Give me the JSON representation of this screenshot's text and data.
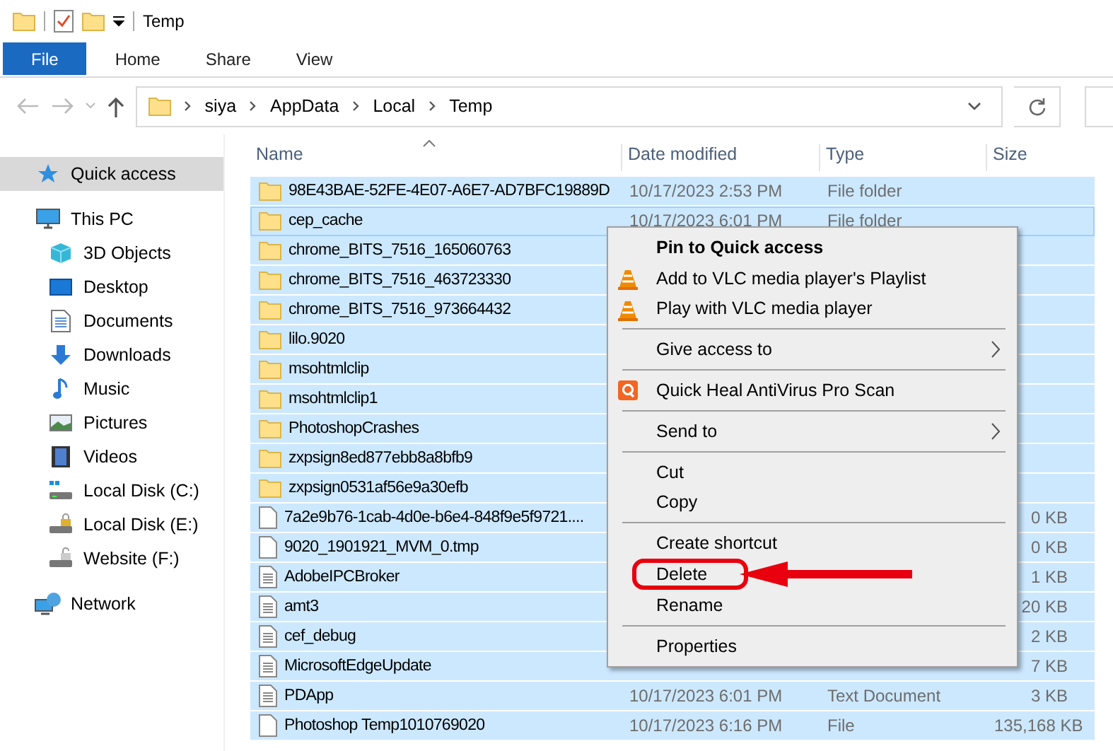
{
  "window": {
    "title": "Temp"
  },
  "ribbon_tabs": [
    {
      "label": "File",
      "kind": "file"
    },
    {
      "label": "Home",
      "kind": "tab"
    },
    {
      "label": "Share",
      "kind": "tab"
    },
    {
      "label": "View",
      "kind": "tab"
    }
  ],
  "address": {
    "path": [
      "siya",
      "AppData",
      "Local",
      "Temp"
    ]
  },
  "sidebar": {
    "items": [
      {
        "label": "Quick access",
        "kind": "star",
        "selected": true
      },
      {
        "label": "This PC",
        "kind": "pc",
        "selected": false,
        "children": [
          {
            "label": "3D Objects",
            "kind": "cube",
            "selected": false
          },
          {
            "label": "Desktop",
            "kind": "desktop",
            "selected": false
          },
          {
            "label": "Documents",
            "kind": "doc",
            "selected": false
          },
          {
            "label": "Downloads",
            "kind": "download",
            "selected": false
          },
          {
            "label": "Music",
            "kind": "music",
            "selected": false
          },
          {
            "label": "Pictures",
            "kind": "pictures",
            "selected": false
          },
          {
            "label": "Videos",
            "kind": "videos",
            "selected": false
          },
          {
            "label": "Local Disk (C:)",
            "kind": "disk-win",
            "selected": false
          },
          {
            "label": "Local Disk (E:)",
            "kind": "disk-lock",
            "selected": false
          },
          {
            "label": "Website (F:)",
            "kind": "disk-open",
            "selected": false
          }
        ]
      },
      {
        "label": "Network",
        "kind": "network",
        "selected": false
      }
    ]
  },
  "table": {
    "columns": [
      {
        "label": "Name",
        "sorted": true
      },
      {
        "label": "Date modified"
      },
      {
        "label": "Type"
      },
      {
        "label": "Size"
      }
    ],
    "rows": [
      {
        "name": "98E43BAE-52FE-4E07-A6E7-AD7BFC19889D",
        "kind": "folder",
        "selected": true,
        "focused": false,
        "date": "10/17/2023 2:53 PM",
        "type": "File folder"
      },
      {
        "name": "cep_cache",
        "kind": "folder",
        "selected": true,
        "focused": true,
        "date": "10/17/2023 6:01 PM",
        "type": "File folder"
      },
      {
        "name": "chrome_BITS_7516_165060763",
        "kind": "folder",
        "selected": true,
        "focused": false
      },
      {
        "name": "chrome_BITS_7516_463723330",
        "kind": "folder",
        "selected": true,
        "focused": false
      },
      {
        "name": "chrome_BITS_7516_973664432",
        "kind": "folder",
        "selected": true,
        "focused": false
      },
      {
        "name": "lilo.9020",
        "kind": "folder",
        "selected": true,
        "focused": false
      },
      {
        "name": "msohtmlclip",
        "kind": "folder",
        "selected": true,
        "focused": false
      },
      {
        "name": "msohtmlclip1",
        "kind": "folder",
        "selected": true,
        "focused": false
      },
      {
        "name": "PhotoshopCrashes",
        "kind": "folder",
        "selected": true,
        "focused": false
      },
      {
        "name": "zxpsign8ed877ebb8a8bfb9",
        "kind": "folder",
        "selected": true,
        "focused": false
      },
      {
        "name": "zxpsign0531af56e9a30efb",
        "kind": "folder",
        "selected": true,
        "focused": false
      },
      {
        "name": "7a2e9b76-1cab-4d0e-b6e4-848f9e5f9721....",
        "kind": "file",
        "selected": true,
        "focused": false,
        "size": "0 KB"
      },
      {
        "name": "9020_1901921_MVM_0.tmp",
        "kind": "file",
        "selected": true,
        "focused": false,
        "size": "0 KB"
      },
      {
        "name": "AdobeIPCBroker",
        "kind": "text",
        "selected": true,
        "focused": false,
        "size": "1 KB"
      },
      {
        "name": "amt3",
        "kind": "text",
        "selected": true,
        "focused": false,
        "size": "20 KB"
      },
      {
        "name": "cef_debug",
        "kind": "text",
        "selected": true,
        "focused": false,
        "size": "2 KB"
      },
      {
        "name": "MicrosoftEdgeUpdate",
        "kind": "text",
        "selected": true,
        "focused": false,
        "size": "7 KB"
      },
      {
        "name": "PDApp",
        "kind": "text",
        "selected": true,
        "focused": false,
        "date": "10/17/2023 6:01 PM",
        "type": "Text Document",
        "size": "3 KB"
      },
      {
        "name": "Photoshop Temp1010769020",
        "kind": "file",
        "selected": true,
        "focused": false,
        "date": "10/17/2023 6:16 PM",
        "type": "File",
        "size": "135,168 KB"
      }
    ]
  },
  "context_menu": {
    "items": [
      {
        "kind": "item",
        "label": "Pin to Quick access",
        "bold": true
      },
      {
        "kind": "vlc",
        "label": "Add to VLC media player's Playlist"
      },
      {
        "kind": "vlc",
        "label": "Play with VLC media player"
      },
      {
        "kind": "separator"
      },
      {
        "kind": "item",
        "label": "Give access to",
        "submenu": true
      },
      {
        "kind": "separator"
      },
      {
        "kind": "scan",
        "label": "Quick Heal AntiVirus Pro Scan"
      },
      {
        "kind": "separator"
      },
      {
        "kind": "item",
        "label": "Send to",
        "submenu": true
      },
      {
        "kind": "separator"
      },
      {
        "kind": "item",
        "label": "Cut"
      },
      {
        "kind": "item",
        "label": "Copy"
      },
      {
        "kind": "separator"
      },
      {
        "kind": "item",
        "label": "Create shortcut"
      },
      {
        "kind": "item",
        "label": "Delete",
        "annotated": true
      },
      {
        "kind": "item",
        "label": "Rename"
      },
      {
        "kind": "separator"
      },
      {
        "kind": "item",
        "label": "Properties"
      }
    ]
  }
}
